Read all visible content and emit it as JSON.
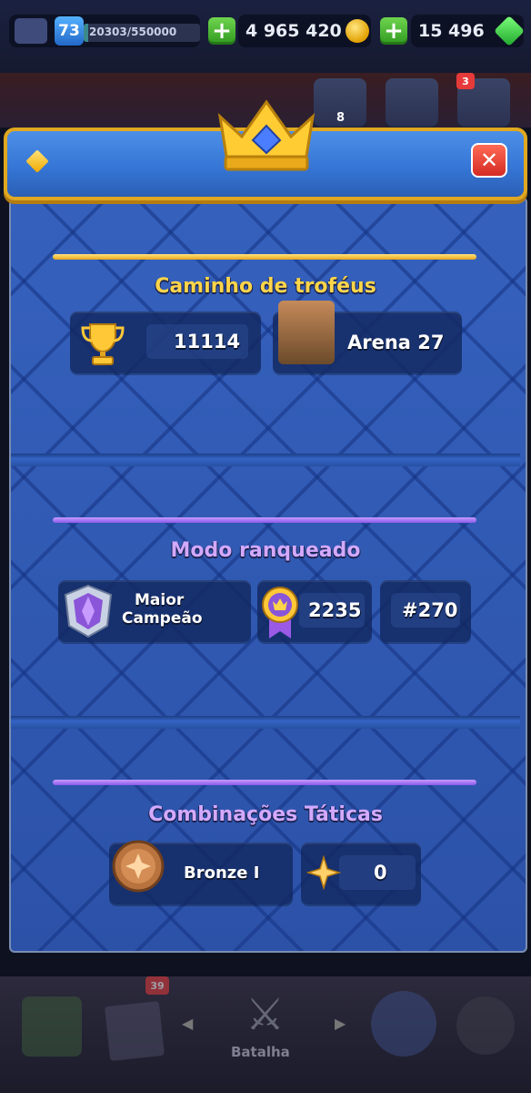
{
  "hud": {
    "level": "73",
    "xp": "20303/550000",
    "xp_progress": 0.037,
    "gold": "4 965 420",
    "gems": "15 496"
  },
  "side": {
    "friends_count": "8",
    "menu_badge": "3"
  },
  "trophy_road": {
    "title": "Caminho de troféus",
    "trophies": "11114",
    "arena": "Arena 27"
  },
  "ranked": {
    "title": "Modo ranqueado",
    "league_line1": "Maior",
    "league_line2": "Campeão",
    "rating": "2235",
    "rank": "#270"
  },
  "tactics": {
    "title": "Combinações Táticas",
    "league": "Bronze I",
    "points": "0"
  },
  "bottom_nav": {
    "cards_badge": "39",
    "battle_label": "Batalha"
  },
  "colors": {
    "panel_blue": "#2c52a8",
    "gold_accent": "#ffd54a",
    "purple_accent": "#d3a9ff",
    "close_red": "#d42b24"
  }
}
